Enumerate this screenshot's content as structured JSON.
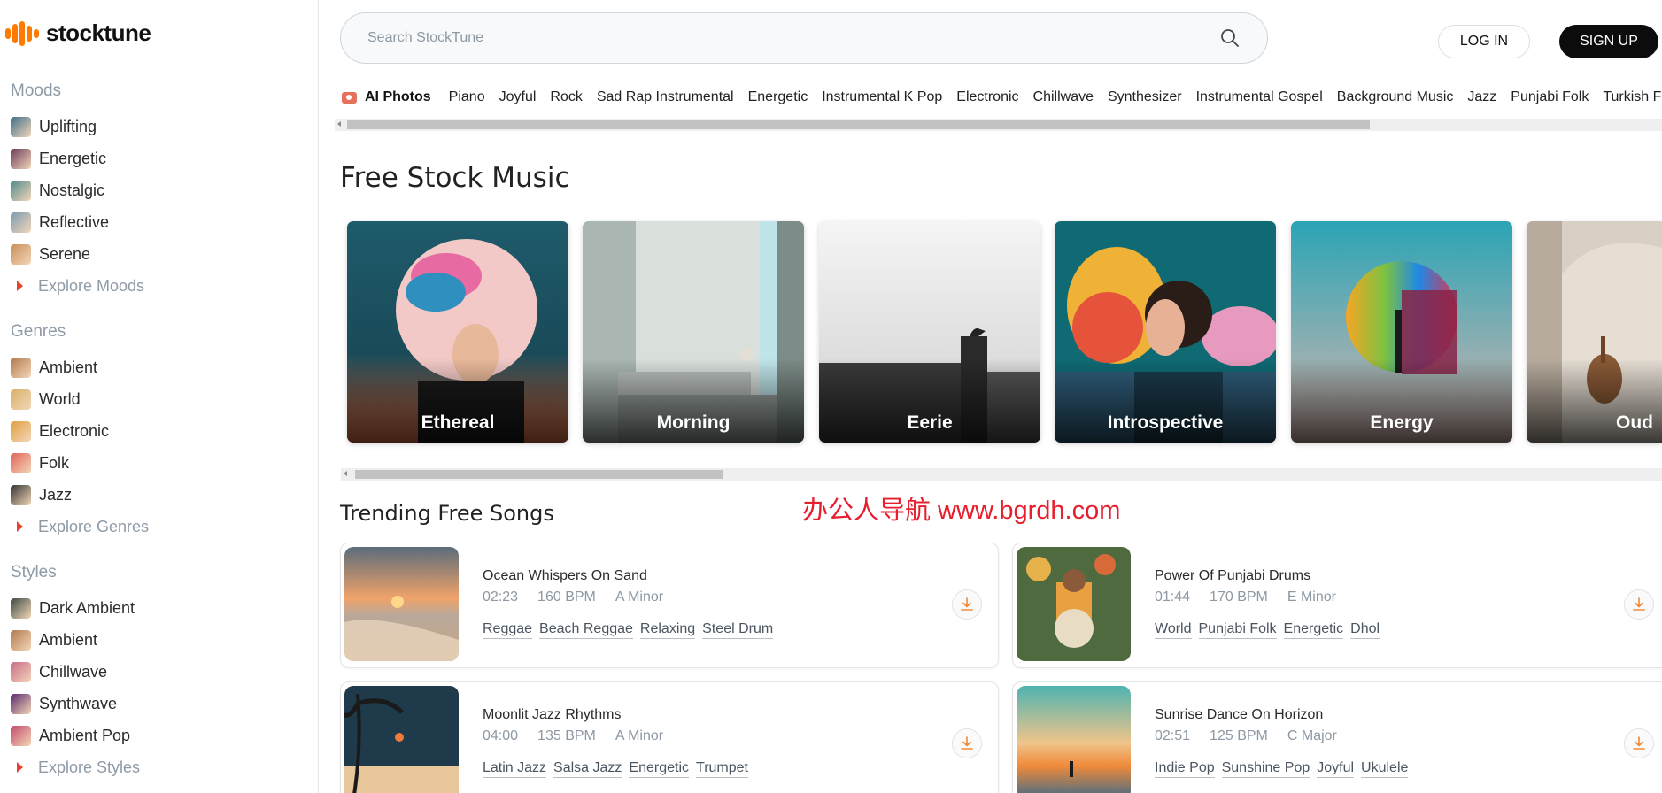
{
  "brand": {
    "name": "stocktune",
    "accent": "#ff7a00"
  },
  "search": {
    "placeholder": "Search StockTune"
  },
  "auth": {
    "login": "LOG IN",
    "signup": "SIGN UP"
  },
  "sidebar": {
    "moods": {
      "heading": "Moods",
      "items": [
        {
          "label": "Uplifting",
          "thumb": "#3d6e8c"
        },
        {
          "label": "Energetic",
          "thumb": "#6b3a5a"
        },
        {
          "label": "Nostalgic",
          "thumb": "#4f8a8b"
        },
        {
          "label": "Reflective",
          "thumb": "#7a9bb0"
        },
        {
          "label": "Serene",
          "thumb": "#c98f5a"
        }
      ],
      "explore": "Explore Moods"
    },
    "genres": {
      "heading": "Genres",
      "items": [
        {
          "label": "Ambient",
          "thumb": "#b07a4e"
        },
        {
          "label": "World",
          "thumb": "#d6b06a"
        },
        {
          "label": "Electronic",
          "thumb": "#e0a040"
        },
        {
          "label": "Folk",
          "thumb": "#e0645a"
        },
        {
          "label": "Jazz",
          "thumb": "#333333"
        }
      ],
      "explore": "Explore Genres"
    },
    "styles": {
      "heading": "Styles",
      "items": [
        {
          "label": "Dark Ambient",
          "thumb": "#3b4a44"
        },
        {
          "label": "Ambient",
          "thumb": "#b07a4e"
        },
        {
          "label": "Chillwave",
          "thumb": "#c96a8a"
        },
        {
          "label": "Synthwave",
          "thumb": "#5a2a6a"
        },
        {
          "label": "Ambient Pop",
          "thumb": "#c24a6a"
        }
      ],
      "explore": "Explore Styles"
    }
  },
  "tags": {
    "ai_label": "AI Photos",
    "items": [
      "Piano",
      "Joyful",
      "Rock",
      "Sad Rap Instrumental",
      "Energetic",
      "Instrumental K Pop",
      "Electronic",
      "Chillwave",
      "Synthesizer",
      "Instrumental Gospel",
      "Background Music",
      "Jazz",
      "Punjabi Folk",
      "Turkish Folk"
    ]
  },
  "free_music": {
    "title": "Free Stock Music",
    "cards": [
      "Ethereal",
      "Morning",
      "Eerie",
      "Introspective",
      "Energy",
      "Oud"
    ]
  },
  "trending": {
    "title": "Trending Free Songs",
    "songs": [
      {
        "title": "Ocean Whispers On Sand",
        "duration": "02:23",
        "bpm": "160 BPM",
        "key": "A Minor",
        "tags": [
          "Reggae",
          "Beach Reggae",
          "Relaxing",
          "Steel Drum"
        ]
      },
      {
        "title": "Power Of Punjabi Drums",
        "duration": "01:44",
        "bpm": "170 BPM",
        "key": "E Minor",
        "tags": [
          "World",
          "Punjabi Folk",
          "Energetic",
          "Dhol"
        ]
      },
      {
        "title": "Moonlit Jazz Rhythms",
        "duration": "04:00",
        "bpm": "135 BPM",
        "key": "A Minor",
        "tags": [
          "Latin Jazz",
          "Salsa Jazz",
          "Energetic",
          "Trumpet"
        ]
      },
      {
        "title": "Sunrise Dance On Horizon",
        "duration": "02:51",
        "bpm": "125 BPM",
        "key": "C Major",
        "tags": [
          "Indie Pop",
          "Sunshine Pop",
          "Joyful",
          "Ukulele"
        ]
      }
    ]
  },
  "watermark": "办公人导航 www.bgrdh.com"
}
